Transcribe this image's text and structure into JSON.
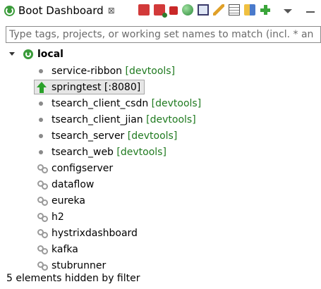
{
  "header": {
    "tab_title": "Boot Dashboard",
    "tab_close": "⊠"
  },
  "toolbar": {
    "icons": [
      "start-icon",
      "debug-icon",
      "stop-icon",
      "open-browser-icon",
      "console-icon",
      "edit-icon",
      "properties-icon",
      "expose-icon",
      "add-icon",
      "view-menu-icon",
      "minimize-icon"
    ]
  },
  "filter": {
    "placeholder": "Type tags, projects, or working set names to match (incl. * an"
  },
  "tree": {
    "root": "local",
    "items": [
      {
        "name": "service-ribbon",
        "tag": "[devtools]",
        "status": "stopped"
      },
      {
        "name": "springtest [:8080]",
        "tag": "",
        "status": "running"
      },
      {
        "name": "tsearch_client_csdn",
        "tag": "[devtools]",
        "status": "stopped"
      },
      {
        "name": "tsearch_client_jian",
        "tag": "[devtools]",
        "status": "stopped"
      },
      {
        "name": "tsearch_server",
        "tag": "[devtools]",
        "status": "stopped"
      },
      {
        "name": "tsearch_web",
        "tag": "[devtools]",
        "status": "stopped"
      },
      {
        "name": "configserver",
        "tag": "",
        "status": "service"
      },
      {
        "name": "dataflow",
        "tag": "",
        "status": "service"
      },
      {
        "name": "eureka",
        "tag": "",
        "status": "service"
      },
      {
        "name": "h2",
        "tag": "",
        "status": "service"
      },
      {
        "name": "hystrixdashboard",
        "tag": "",
        "status": "service"
      },
      {
        "name": "kafka",
        "tag": "",
        "status": "service"
      },
      {
        "name": "stubrunner",
        "tag": "",
        "status": "service"
      }
    ]
  },
  "footer": {
    "status": "5 elements hidden by filter"
  }
}
